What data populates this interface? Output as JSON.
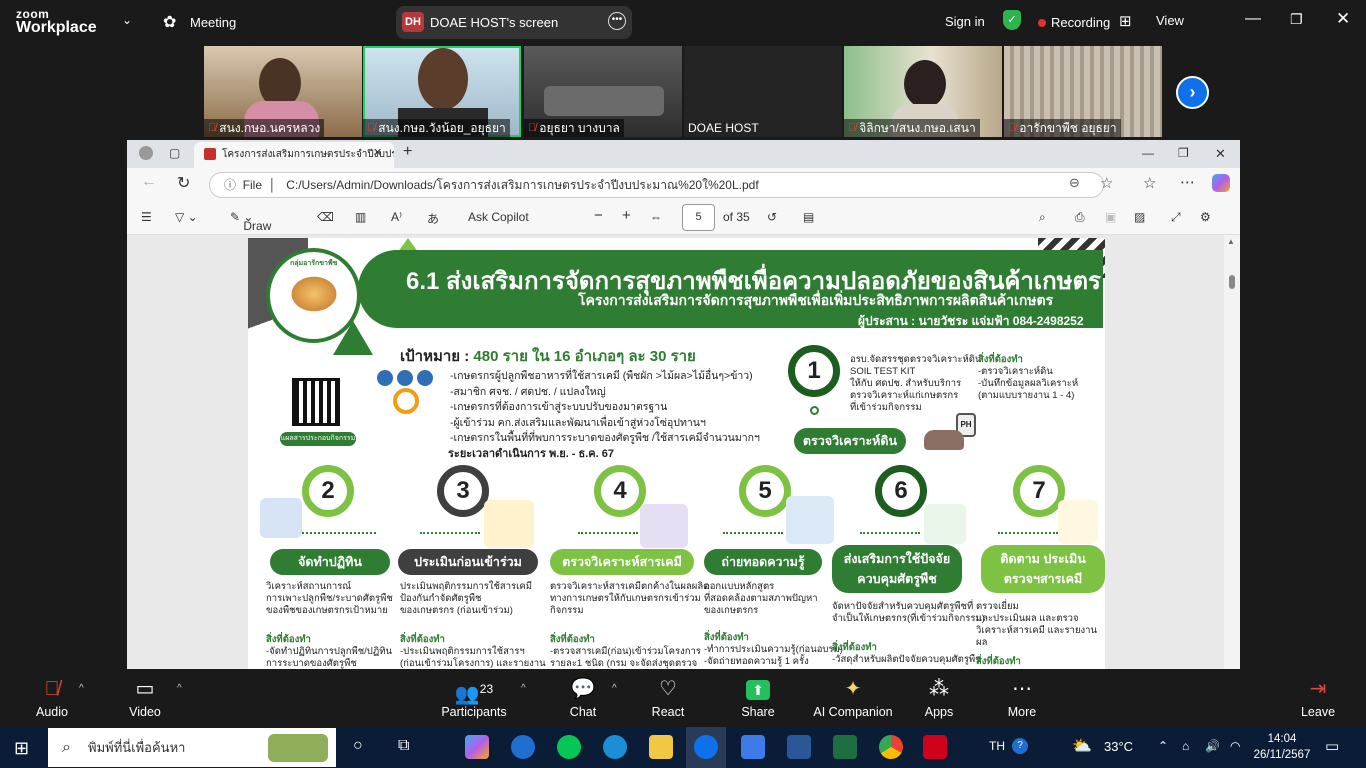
{
  "zoom": {
    "brand_line1": "zoom",
    "brand_line2": "Workplace",
    "meeting_label": "Meeting",
    "share_badge": "DH",
    "share_label": "DOAE HOST's screen",
    "sign_in": "Sign in",
    "recording": "Recording",
    "view": "View",
    "participants_count": "23",
    "participants": [
      {
        "name": "สนง.กษอ.นครหลวง",
        "muted": true
      },
      {
        "name": "สนง.กษอ.วังน้อย_อยุธยา",
        "muted": true,
        "active": true
      },
      {
        "name": "อยุธยา บางบาล",
        "muted": true
      },
      {
        "name": "DOAE HOST",
        "muted": false
      },
      {
        "name": "จิลิกษา/สนง.กษอ.เสนา",
        "muted": true
      },
      {
        "name": "อารักขาพืช อยุธยา",
        "muted": true
      }
    ],
    "toolbar": {
      "audio": "Audio",
      "video": "Video",
      "participants": "Participants",
      "chat": "Chat",
      "react": "React",
      "share": "Share",
      "ai": "AI Companion",
      "apps": "Apps",
      "more": "More",
      "leave": "Leave"
    }
  },
  "browser": {
    "tab_title": "โครงการส่งเสริมการเกษตรประจำปีงบประ",
    "file_label": "File",
    "url": "C:/Users/Admin/Downloads/โครงการส่งเสริมการเกษตรประจำปีงบประมาณ%20ใ%20L.pdf",
    "pdf": {
      "draw": "Draw",
      "ask_copilot": "Ask Copilot",
      "page": "5",
      "of_pages": "of 35"
    }
  },
  "slide": {
    "title": "6.1 ส่งเสริมการจัดการสุขภาพพืชเพื่อความปลอดภัยของสินค้าเกษตร",
    "subtitle": "โครงการส่งเสริมการจัดการสุขภาพพืชเพื่อเพิ่มประสิทธิภาพการผลิตสินค้าเกษตร",
    "coordinator": "ผู้ประสาน : นายวัชระ แจ่มฟ้า 084-2498252",
    "logo_text": "กลุ่มอารักขาพืช",
    "qr_label": "แผลสารประกอบกิจกรรม",
    "goal_prefix": "เป้าหมาย :",
    "goal_value": "480 ราย ใน 16 อำเภอๆ ละ 30 ราย",
    "bullets": [
      "-เกษตรกรผู้ปลูกพืชอาหารที่ใช้สารเคมี (พืชผัก >ไม้ผล>ไม้อื่นๆ>ข้าว)",
      "-สมาชิก ศจช. / ศดปช. / แปลงใหญ่",
      "-เกษตรกรที่ต้องการเข้าสู่ระบบปรับของมาตรฐาน",
      "-ผู้เข้าร่วม คก.ส่งเสริมและพัฒนาเพื่อเข้าสู่ห่วงโซ่อุปทานฯ",
      "-เกษตรกรในพื้นที่ที่พบการระบาดของศัตรูพืช /ใช้สารเคมีจำนวนมากฯ"
    ],
    "period": "ระยะเวลาดำเนินการ พ.ย. - ธ.ค. 67",
    "step1": {
      "num": "1",
      "label": "ตรวจวิเคราะห์ดิน",
      "desc": [
        "อรบ.จัดสรรชุดตรวจวิเคราะห์ดิน",
        "SOIL TEST KIT",
        "ให้กับ ศดปช. สำหรับบริการ",
        "ตรวจวิเคราะห์แก่เกษตรกร",
        "ที่เข้าร่วมกิจกรรม"
      ],
      "need_title": "สิ่งที่ต้องทำ",
      "need": [
        "-ตรวจวิเคราะห์ดิน",
        "-บันทึกข้อมูลผลวิเคราะห์",
        "(ตามแบบรายงาน 1 - 4)"
      ],
      "ph": "PH"
    },
    "steps": [
      {
        "num": "2",
        "label": "จัดทำปฏิทิน",
        "desc": [
          "วิเคราะห์สถานการณ์",
          "การเพาะปลูกพืช/ระบาดศัตรูพืช",
          "ของพืชของเกษตรกรเป้าหมาย"
        ],
        "need_title": "สิ่งที่ต้องทำ",
        "need": [
          "-จัดทำปฏิทินการปลูกพืช/ปฏิทิน",
          "การระบาดของศัตรูพืช"
        ]
      },
      {
        "num": "3",
        "label": "ประเมินก่อนเข้าร่วม",
        "desc": [
          "ประเมินพฤติกรรมการใช้สารเคมี",
          "ป้องกันกำจัดศัตรูพืช",
          "ของเกษตรกร (ก่อนเข้าร่วม)"
        ],
        "need_title": "สิ่งที่ต้องทำ",
        "need": [
          "-ประเมินพฤติกรรมการใช้สารฯ",
          "(ก่อนเข้าร่วมโครงการ) และรายงาน"
        ]
      },
      {
        "num": "4",
        "label": "ตรวจวิเคราะห์สารเคมี",
        "desc": [
          "ตรวจวิเคราะห์สารเคมีตกค้างในผลผลิต",
          "ทางการเกษตรให้กับเกษตรกรเข้าร่วม",
          "กิจกรรม"
        ],
        "need_title": "สิ่งที่ต้องทำ",
        "need": [
          "-ตรวจสารเคมี(ก่อน)เข้าร่วมโครงการ",
          "รายละ1 ชนิด (กรม จะจัดส่งชุดตรวจ"
        ]
      },
      {
        "num": "5",
        "label": "ถ่ายทอดความรู้",
        "desc": [
          "ออกแบบหลักสูตร",
          "ที่สอดคล้องตามสภาพปัญหา",
          "ของเกษตรกร"
        ],
        "need_title": "สิ่งที่ต้องทำ",
        "need": [
          "-ทำการประเมินความรู้(ก่อนอบรม)",
          "-จัดถ่ายทอดความรู้ 1 ครั้ง"
        ]
      },
      {
        "num": "6",
        "label_1": "ส่งเสริมการใช้ปัจจัย",
        "label_2": "ควบคุมศัตรูพืช",
        "desc": [
          "จัดหาปัจจัยสำหรับควบคุมศัตรูพืชที่",
          "จำเป็นให้เกษตรกร(ที่เข้าร่วมกิจกรรม)"
        ],
        "need_title": "สิ่งที่ต้องทำ",
        "need": [
          "-วัสดุสำหรับผลิตปัจจัยควบคุมศัตรูพืช"
        ]
      },
      {
        "num": "7",
        "label_1": "ติดตาม ประเมิน",
        "label_2": "ตรวจฯสารเคมี",
        "desc": [
          "ตรวจเยี่ยม",
          "และประเมินผล และตรวจ",
          "วิเคราะห์สารเคมี และรายงานผล"
        ],
        "need_title": "สิ่งที่ต้องทำ",
        "need": []
      }
    ]
  },
  "taskbar": {
    "search_placeholder": "พิมพ์ที่นี่เพื่อค้นหา",
    "lang": "TH",
    "temp": "33°C",
    "time": "14:04",
    "date": "26/11/2567"
  }
}
